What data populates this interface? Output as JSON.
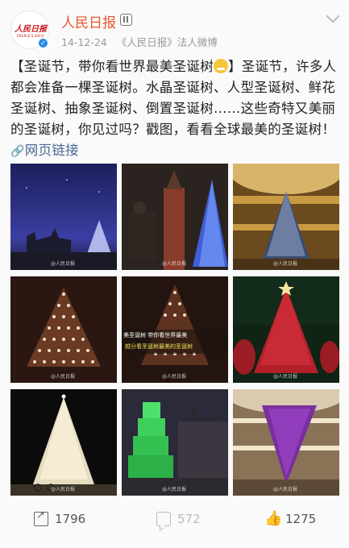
{
  "account": {
    "name": "人民日报",
    "avatar_logo": "人民日报",
    "date": "14-12-24",
    "source": "《人民日报》法人微博"
  },
  "post": {
    "text_part1": "【圣诞节，带你看世界最美圣诞树",
    "text_part2": "】圣诞节，许多人都会准备一棵圣诞树。水晶圣诞树、人型圣诞树、鲜花圣诞树、抽象圣诞树、倒置圣诞树……这些奇特又美丽的圣诞树，你见过吗？戳图，看看全球最美的圣诞树！",
    "link_label": "网页链接"
  },
  "images": [
    {
      "name": "castle-night-tree"
    },
    {
      "name": "statue-tower-tree"
    },
    {
      "name": "gallery-dome-tree"
    },
    {
      "name": "people-tree"
    },
    {
      "name": "people-tree-caption",
      "caption_line1": "美圣诞树 带你看世界最美",
      "caption_line2": "越分看圣诞树最美的圣诞树"
    },
    {
      "name": "red-flower-tree"
    },
    {
      "name": "stadium-tree"
    },
    {
      "name": "green-crystal-tree"
    },
    {
      "name": "upside-down-tree"
    }
  ],
  "watermark": "@人民日报",
  "actions": {
    "repost_count": "1796",
    "comment_count": "572",
    "like_count": "1275"
  }
}
